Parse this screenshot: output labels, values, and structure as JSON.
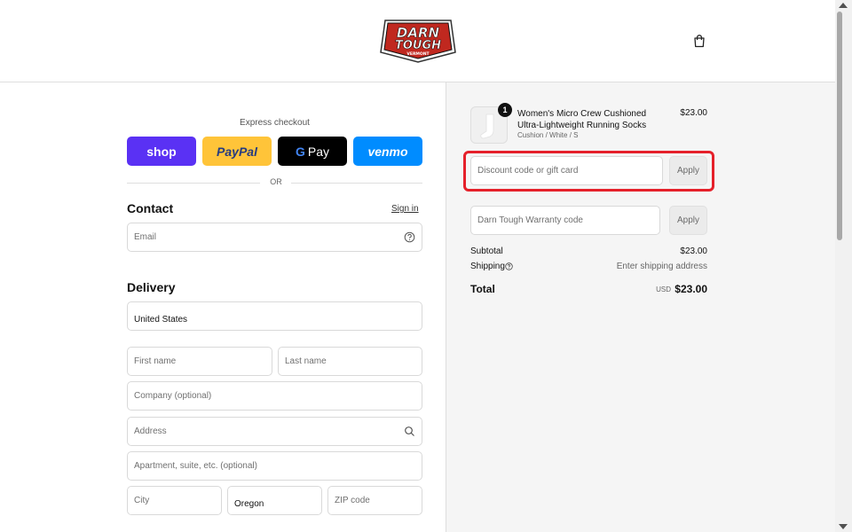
{
  "brand": {
    "logo_line1": "DARN",
    "logo_line2": "TOUGH",
    "logo_line3": "VERMONT"
  },
  "header": {
    "cart_icon": "shopping-bag-icon"
  },
  "express": {
    "label": "Express checkout",
    "buttons": [
      "shop",
      "PayPal",
      "Pay",
      "venmo"
    ],
    "gpay_letter": "G",
    "or_text": "OR"
  },
  "contact": {
    "title": "Contact",
    "sign_in": "Sign in",
    "email_placeholder": "Email",
    "help_icon": "question-circle-icon"
  },
  "delivery": {
    "title": "Delivery",
    "country": "United States",
    "first_name_placeholder": "First name",
    "last_name_placeholder": "Last name",
    "company_placeholder": "Company (optional)",
    "address_placeholder": "Address",
    "address_icon": "search-icon",
    "apartment_placeholder": "Apartment, suite, etc. (optional)",
    "city_placeholder": "City",
    "state": "Oregon",
    "zip_placeholder": "ZIP code"
  },
  "order": {
    "item": {
      "quantity": "1",
      "name": "Women's Micro Crew Cushioned Ultra-Lightweight Running Socks",
      "variant": "Cushion / White / S",
      "price": "$23.00"
    },
    "discount_placeholder": "Discount code or gift card",
    "discount_apply": "Apply",
    "warranty_placeholder": "Darn Tough Warranty code",
    "warranty_apply": "Apply",
    "subtotal_label": "Subtotal",
    "subtotal_value": "$23.00",
    "shipping_label": "Shipping",
    "shipping_value": "Enter shipping address",
    "total_label": "Total",
    "currency": "USD",
    "total_value": "$23.00"
  },
  "colors": {
    "shop_pay": "#5a31f4",
    "paypal": "#ffc439",
    "gpay": "#000000",
    "venmo": "#008cff",
    "highlight": "#e5202a",
    "logo_red": "#c0281f"
  }
}
